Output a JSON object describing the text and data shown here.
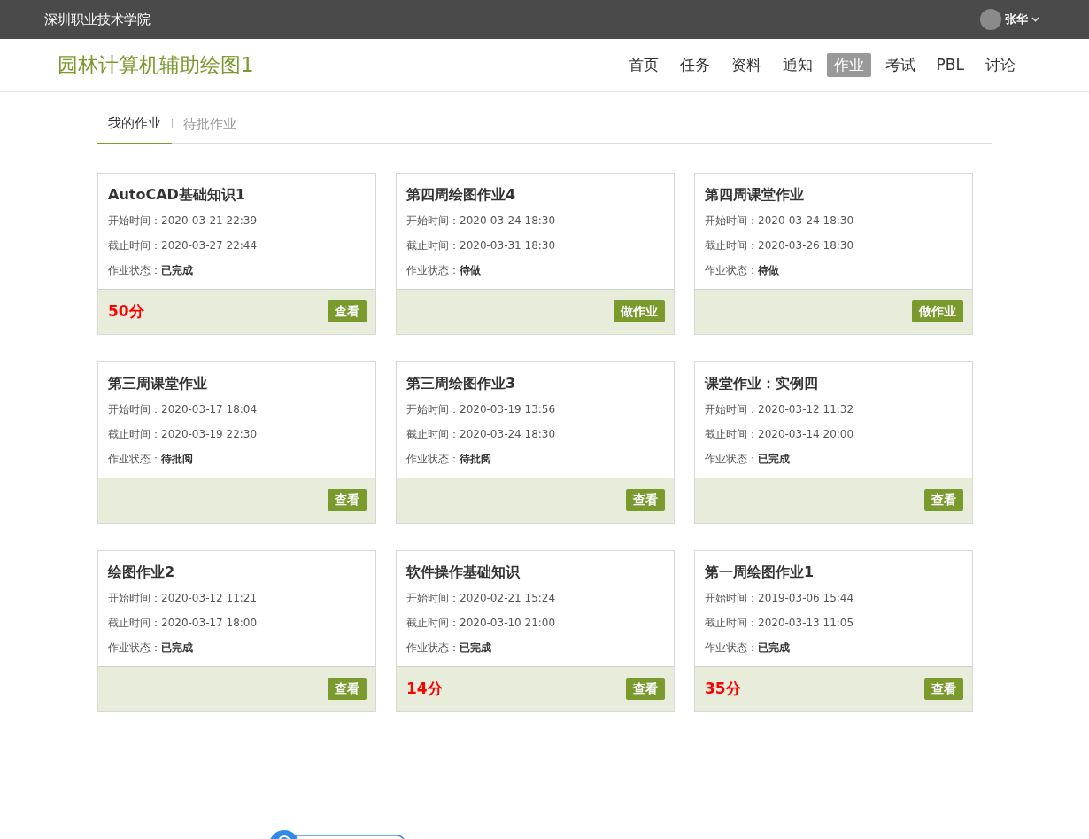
{
  "topbar": {
    "school": "深圳职业技术学院",
    "user": "张华"
  },
  "header": {
    "course": "园林计算机辅助绘图1",
    "nav": [
      {
        "label": "首页",
        "selected": false
      },
      {
        "label": "任务",
        "selected": false
      },
      {
        "label": "资料",
        "selected": false
      },
      {
        "label": "通知",
        "selected": false
      },
      {
        "label": "作业",
        "selected": true
      },
      {
        "label": "考试",
        "selected": false
      },
      {
        "label": "PBL",
        "selected": false
      },
      {
        "label": "讨论",
        "selected": false
      }
    ]
  },
  "tabs": [
    {
      "label": "我的作业",
      "selected": true
    },
    {
      "label": "待批作业",
      "selected": false
    }
  ],
  "assignments": [
    {
      "title": "AutoCAD基础知识1",
      "start": "开始时间：2020-03-21 22:39",
      "end": "截止时间：2020-03-27 22:44",
      "status": "作业状态：**已完成**",
      "score": "50分",
      "button": "查看"
    },
    {
      "title": "第四周绘图作业4",
      "start": "开始时间：2020-03-24 18:30",
      "end": "截止时间：2020-03-31 18:30",
      "status": "作业状态：**待做**",
      "button": "做作业"
    },
    {
      "title": "第四周课堂作业",
      "start": "开始时间：2020-03-24 18:30",
      "end": "截止时间：2020-03-26 18:30",
      "status": "作业状态：**待做**",
      "button": "做作业"
    },
    {
      "title": "第三周课堂作业",
      "start": "开始时间：2020-03-17 18:04",
      "end": "截止时间：2020-03-19 22:30",
      "status": "作业状态：**待批阅**",
      "button": "查看"
    },
    {
      "title": "第三周绘图作业3",
      "start": "开始时间：2020-03-19 13:56",
      "end": "截止时间：2020-03-24 18:30",
      "status": "作业状态：**待批阅**",
      "button": "查看"
    },
    {
      "title": "课堂作业：实例四",
      "start": "开始时间：2020-03-12 11:32",
      "end": "截止时间：2020-03-14 20:00",
      "status": "作业状态：**已完成**",
      "button": "查看"
    },
    {
      "title": "绘图作业2",
      "start": "开始时间：2020-03-12 11:21",
      "end": "截止时间：2020-03-17 18:00",
      "status": "作业状态：**已完成**",
      "button": "查看"
    },
    {
      "title": "软件操作基础知识",
      "start": "开始时间：2020-02-21 15:24",
      "end": "截止时间：2020-03-10 21:00",
      "status": "作业状态：**已完成**",
      "score": "14分",
      "button": "查看"
    },
    {
      "title": "第一周绘图作业1",
      "start": "开始时间：2019-03-06 15:44",
      "end": "截止时间：2020-03-13 11:05",
      "status": "作业状态：**已完成**",
      "score": "35分",
      "button": "查看"
    }
  ]
}
